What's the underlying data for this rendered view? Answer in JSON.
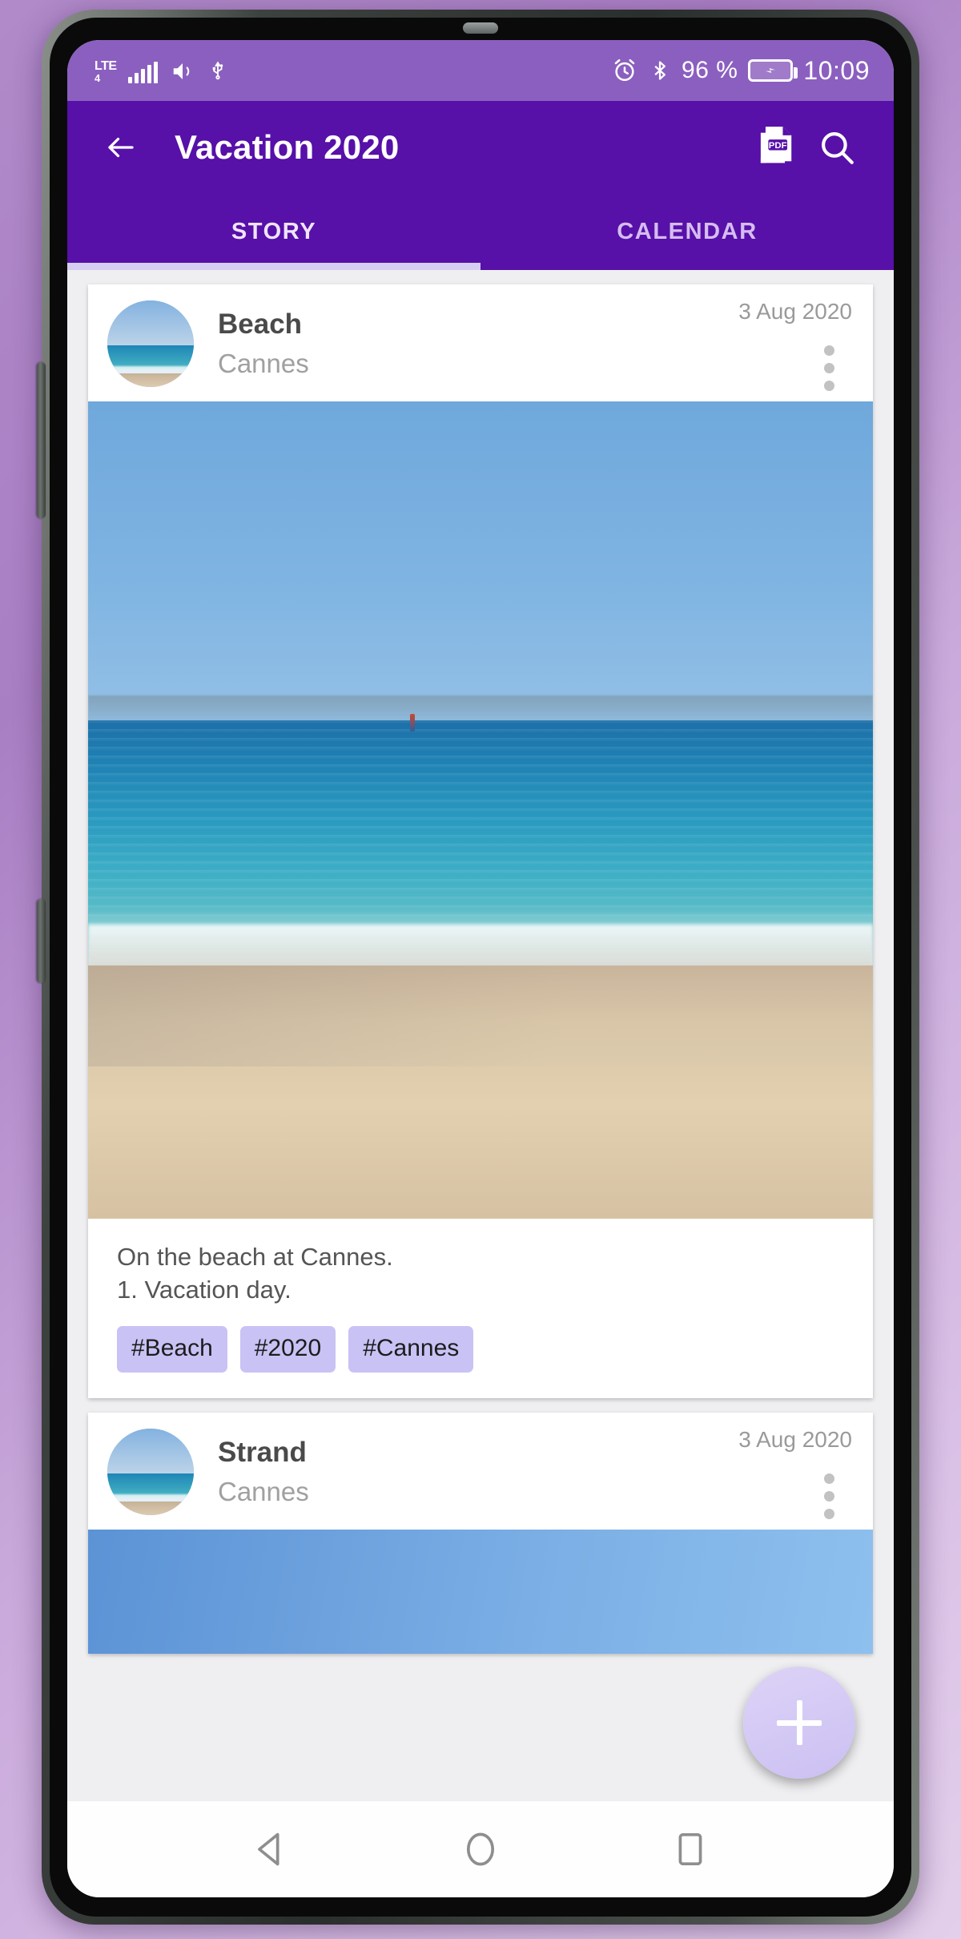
{
  "status_bar": {
    "network_label_top": "LTE",
    "network_label_bottom": "4",
    "volume_icon": "volume-icon",
    "usb_icon": "usb-icon",
    "alarm_icon": "alarm-icon",
    "bluetooth_icon": "bluetooth-icon",
    "battery_percent": "96 %",
    "battery_icon": "battery-charging-icon",
    "clock": "10:09"
  },
  "app_bar": {
    "back_icon": "back-arrow-icon",
    "title": "Vacation 2020",
    "pdf_icon": "pdf-icon",
    "pdf_label": "PDF",
    "search_icon": "search-icon"
  },
  "tabs": {
    "items": [
      {
        "label": "STORY",
        "active": true
      },
      {
        "label": "CALENDAR",
        "active": false
      }
    ]
  },
  "entries": [
    {
      "title": "Beach",
      "location": "Cannes",
      "date": "3 Aug 2020",
      "menu_icon": "more-vertical-icon",
      "avatar_icon": "beach-thumbnail",
      "photo_alt": "beach-photo",
      "caption_line1": "On the beach at Cannes.",
      "caption_line2": "1. Vacation day.",
      "tags": [
        "#Beach",
        "#2020",
        "#Cannes"
      ]
    },
    {
      "title": "Strand",
      "location": "Cannes",
      "date": "3 Aug 2020",
      "menu_icon": "more-vertical-icon",
      "avatar_icon": "beach-thumbnail",
      "photo_alt": "sky-photo"
    }
  ],
  "fab": {
    "icon": "plus-icon",
    "label": "+"
  },
  "nav_bar": {
    "back_icon": "nav-back-triangle-icon",
    "home_icon": "nav-home-circle-icon",
    "recents_icon": "nav-recents-square-icon"
  },
  "colors": {
    "status_bar_bg": "#8b5fbf",
    "app_bar_bg": "#5710a8",
    "tab_indicator": "#d6cdf2",
    "tag_bg": "#c9c2f5",
    "fab_bg": "#d5cbf5",
    "content_bg": "#efeff1"
  }
}
